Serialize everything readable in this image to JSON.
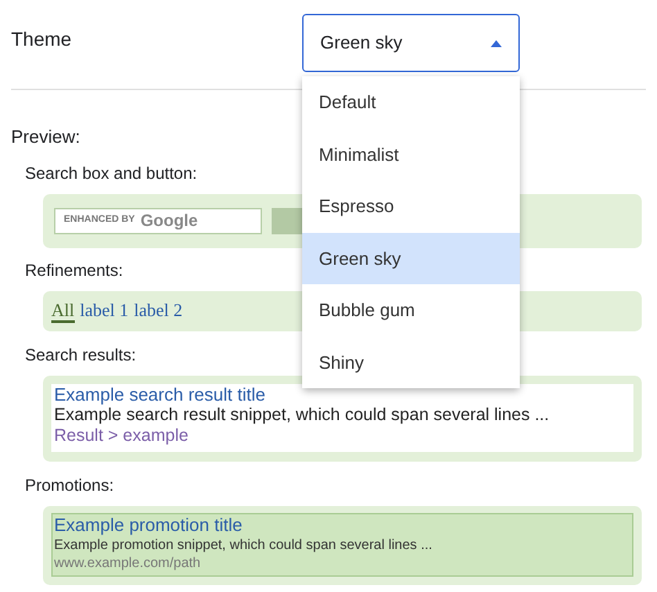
{
  "theme": {
    "label": "Theme",
    "value": "Green sky",
    "expanded": true,
    "options": [
      {
        "label": "Default",
        "selected": false
      },
      {
        "label": "Minimalist",
        "selected": false
      },
      {
        "label": "Espresso",
        "selected": false
      },
      {
        "label": "Green sky",
        "selected": true
      },
      {
        "label": "Bubble gum",
        "selected": false
      },
      {
        "label": "Shiny",
        "selected": false
      }
    ]
  },
  "preview": {
    "heading": "Preview:",
    "search_box": {
      "label": "Search box and button:",
      "branding_prefix": "ENHANCED BY",
      "branding_name": "Google"
    },
    "refinements": {
      "label": "Refinements:",
      "tabs": [
        {
          "label": "All",
          "selected": true
        },
        {
          "label": "label 1",
          "selected": false
        },
        {
          "label": "label 2",
          "selected": false
        }
      ]
    },
    "search_result": {
      "label": "Search results:",
      "title": "Example search result title",
      "snippet": "Example search result snippet, which could span several lines ...",
      "breadcrumb": "Result > example"
    },
    "promotion": {
      "label": "Promotions:",
      "title": "Example promotion title",
      "snippet": "Example promotion snippet, which could span several lines ...",
      "url": "www.example.com/path"
    }
  }
}
